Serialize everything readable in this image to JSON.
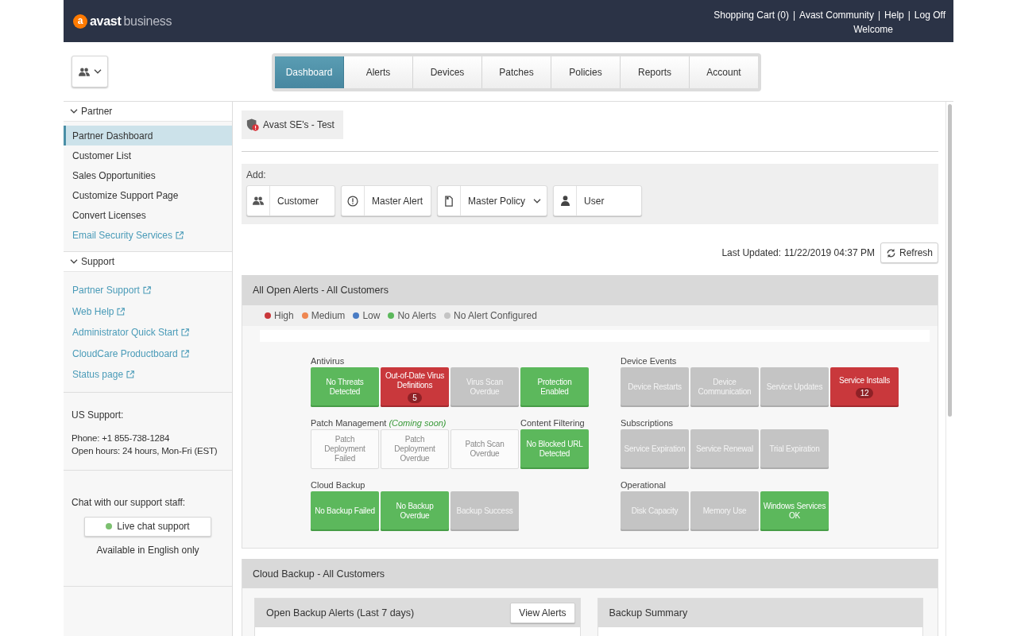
{
  "header": {
    "logo": {
      "mark": "a",
      "brand": "avast",
      "product": "business"
    },
    "links": [
      {
        "label": "Shopping Cart (0)"
      },
      {
        "separator": "|",
        "label": "Avast Community"
      },
      {
        "separator": "|",
        "label": "Help"
      },
      {
        "separator": "|",
        "label": "Log Off"
      }
    ],
    "welcome": "Welcome"
  },
  "nav_tabs": [
    {
      "label": "Dashboard",
      "selected": true
    },
    {
      "label": "Alerts",
      "selected": false
    },
    {
      "label": "Devices",
      "selected": false
    },
    {
      "label": "Patches",
      "selected": false
    },
    {
      "label": "Policies",
      "selected": false
    },
    {
      "label": "Reports",
      "selected": false
    },
    {
      "label": "Account",
      "selected": false
    }
  ],
  "sidebar": {
    "sections": [
      {
        "title": "Partner",
        "expanded": true,
        "items": [
          {
            "label": "Partner Dashboard",
            "kind": "page",
            "selected": true
          },
          {
            "label": "Customer List",
            "kind": "page",
            "selected": false
          },
          {
            "label": "Sales Opportunities",
            "kind": "page",
            "selected": false
          },
          {
            "label": "Customize Support Page",
            "kind": "page",
            "selected": false
          },
          {
            "label": "Convert Licenses",
            "kind": "page",
            "selected": false
          },
          {
            "label": "Email Security Services",
            "kind": "external",
            "selected": false
          }
        ]
      },
      {
        "title": "Support",
        "expanded": true,
        "items": [
          {
            "label": "Partner Support",
            "kind": "external",
            "selected": false
          },
          {
            "label": "Web Help",
            "kind": "external",
            "selected": false
          },
          {
            "label": "Administrator Quick Start",
            "kind": "external",
            "selected": false
          },
          {
            "label": "CloudCare Productboard",
            "kind": "external",
            "selected": false
          },
          {
            "label": "Status page",
            "kind": "external",
            "selected": false
          }
        ]
      }
    ],
    "contact": {
      "title": "US Support:",
      "lines": [
        "Phone: +1 855-738-1284",
        "Open hours: 24 hours, Mon-Fri (EST)"
      ]
    },
    "chat": {
      "prompt": "Chat with our support staff:",
      "button": "Live chat support",
      "note": "Available in English only"
    }
  },
  "customer_tab": {
    "label": "Avast SE's - Test"
  },
  "add_panel": {
    "label": "Add:",
    "buttons": [
      {
        "kind": "customer",
        "label": "Customer",
        "dropdown": false
      },
      {
        "kind": "alert",
        "label": "Master Alert",
        "dropdown": false
      },
      {
        "kind": "policy",
        "label": "Master Policy",
        "dropdown": true
      },
      {
        "kind": "user",
        "label": "User",
        "dropdown": false
      }
    ]
  },
  "last_updated": {
    "label": "Last Updated:",
    "value": "11/22/2019 04:37 PM",
    "refresh_button": "Refresh"
  },
  "alerts_panel": {
    "title": "All Open Alerts - All Customers",
    "legend": [
      {
        "label": "High",
        "color": "#c9373a"
      },
      {
        "label": "Medium",
        "color": "#ef8751"
      },
      {
        "label": "Low",
        "color": "#4a7cc4"
      },
      {
        "label": "No Alerts",
        "color": "#5cb85c"
      },
      {
        "label": "No Alert Configured",
        "color": "#c4c4c4"
      }
    ],
    "columns": [
      {
        "groups": [
          {
            "title": "Antivirus",
            "tiles": [
              {
                "label": "No Threats Detected",
                "kind": "ok"
              },
              {
                "label": "Out-of-Date Virus Definitions",
                "kind": "high",
                "count": "5"
              },
              {
                "label": "Virus Scan Overdue",
                "kind": "unconfigured"
              },
              {
                "label": "Protection Enabled",
                "kind": "ok"
              }
            ]
          },
          {
            "title": "Patch Management",
            "note": "(Coming soon)",
            "tiles": [
              {
                "label": "Patch Deployment Failed",
                "kind": "unavailable"
              },
              {
                "label": "Patch Deployment Overdue",
                "kind": "unavailable"
              },
              {
                "label": "Patch Scan Overdue",
                "kind": "unavailable"
              }
            ]
          },
          {
            "title": "Content Filtering",
            "tiles": [
              {
                "label": "No Blocked URL Detected",
                "kind": "ok"
              }
            ]
          },
          {
            "title": "Cloud Backup",
            "tiles": [
              {
                "label": "No Backup Failed",
                "kind": "ok"
              },
              {
                "label": "No Backup Overdue",
                "kind": "ok"
              },
              {
                "label": "Backup Success",
                "kind": "unconfigured"
              }
            ]
          }
        ]
      },
      {
        "groups": [
          {
            "title": "Device Events",
            "tiles": [
              {
                "label": "Device Restarts",
                "kind": "unconfigured"
              },
              {
                "label": "Device Communication",
                "kind": "unconfigured"
              },
              {
                "label": "Service Updates",
                "kind": "unconfigured"
              },
              {
                "label": "Service Installs",
                "kind": "high",
                "count": "12"
              }
            ]
          },
          {
            "title": "Subscriptions",
            "tiles": [
              {
                "label": "Service Expiration",
                "kind": "unconfigured"
              },
              {
                "label": "Service Renewal",
                "kind": "unconfigured"
              },
              {
                "label": "Trial Expiration",
                "kind": "unconfigured"
              }
            ]
          },
          {
            "title": "Operational",
            "tiles": [
              {
                "label": "Disk Capacity",
                "kind": "unconfigured"
              },
              {
                "label": "Memory Use",
                "kind": "unconfigured"
              },
              {
                "label": "Windows Services OK",
                "kind": "ok"
              }
            ]
          }
        ]
      }
    ]
  },
  "cloud_backup_panel": {
    "title": "Cloud Backup - All Customers",
    "cards": [
      {
        "title": "Open Backup Alerts (Last 7 days)",
        "button": "View Alerts"
      },
      {
        "title": "Backup Summary"
      }
    ]
  }
}
